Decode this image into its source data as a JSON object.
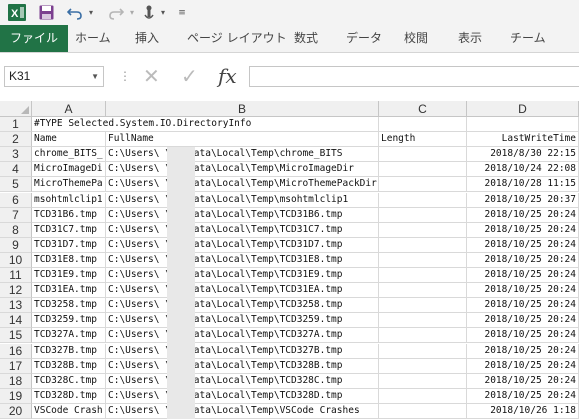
{
  "qat": {
    "excel_icon": "excel-logo-icon",
    "save_icon": "save-icon",
    "undo_icon": "undo-icon",
    "redo_icon": "redo-icon",
    "touch_icon": "touch-mode-icon",
    "customize_icon": "customize-qat-icon"
  },
  "ribbon": {
    "tabs": [
      "ファイル",
      "ホーム",
      "挿入",
      "ページ レイアウト",
      "数式",
      "データ",
      "校閲",
      "表示",
      "チーム"
    ]
  },
  "formula_bar": {
    "name_box": "K31",
    "formula": ""
  },
  "columns": [
    "A",
    "B",
    "C",
    "D"
  ],
  "rows": [
    {
      "n": "1",
      "a": "#TYPE Selected.System.IO.DirectoryInfo",
      "b": "",
      "c": "",
      "d": ""
    },
    {
      "n": "2",
      "a": "Name",
      "b": "FullName",
      "c": "Length",
      "d": "LastWriteTime"
    },
    {
      "n": "3",
      "a": "chrome_BITS_",
      "b": "C:\\Users\\     \\AppData\\Local\\Temp\\chrome_BITS",
      "c": "",
      "d": "2018/8/30 22:15"
    },
    {
      "n": "4",
      "a": "MicroImageDi",
      "b": "C:\\Users\\     \\AppData\\Local\\Temp\\MicroImageDir",
      "c": "",
      "d": "2018/10/24 22:08"
    },
    {
      "n": "5",
      "a": "MicroThemePa",
      "b": "C:\\Users\\     \\AppData\\Local\\Temp\\MicroThemePackDir",
      "c": "",
      "d": "2018/10/28 11:15"
    },
    {
      "n": "6",
      "a": "msohtmlclip1",
      "b": "C:\\Users\\     \\AppData\\Local\\Temp\\msohtmlclip1",
      "c": "",
      "d": "2018/10/25 20:37"
    },
    {
      "n": "7",
      "a": "TCD31B6.tmp",
      "b": "C:\\Users\\     \\AppData\\Local\\Temp\\TCD31B6.tmp",
      "c": "",
      "d": "2018/10/25 20:24"
    },
    {
      "n": "8",
      "a": "TCD31C7.tmp",
      "b": "C:\\Users\\     \\AppData\\Local\\Temp\\TCD31C7.tmp",
      "c": "",
      "d": "2018/10/25 20:24"
    },
    {
      "n": "9",
      "a": "TCD31D7.tmp",
      "b": "C:\\Users\\     \\AppData\\Local\\Temp\\TCD31D7.tmp",
      "c": "",
      "d": "2018/10/25 20:24"
    },
    {
      "n": "10",
      "a": "TCD31E8.tmp",
      "b": "C:\\Users\\     \\AppData\\Local\\Temp\\TCD31E8.tmp",
      "c": "",
      "d": "2018/10/25 20:24"
    },
    {
      "n": "11",
      "a": "TCD31E9.tmp",
      "b": "C:\\Users\\     \\AppData\\Local\\Temp\\TCD31E9.tmp",
      "c": "",
      "d": "2018/10/25 20:24"
    },
    {
      "n": "12",
      "a": "TCD31EA.tmp",
      "b": "C:\\Users\\     \\AppData\\Local\\Temp\\TCD31EA.tmp",
      "c": "",
      "d": "2018/10/25 20:24"
    },
    {
      "n": "13",
      "a": "TCD3258.tmp",
      "b": "C:\\Users\\     \\AppData\\Local\\Temp\\TCD3258.tmp",
      "c": "",
      "d": "2018/10/25 20:24"
    },
    {
      "n": "14",
      "a": "TCD3259.tmp",
      "b": "C:\\Users\\     \\AppData\\Local\\Temp\\TCD3259.tmp",
      "c": "",
      "d": "2018/10/25 20:24"
    },
    {
      "n": "15",
      "a": "TCD327A.tmp",
      "b": "C:\\Users\\     \\AppData\\Local\\Temp\\TCD327A.tmp",
      "c": "",
      "d": "2018/10/25 20:24"
    },
    {
      "n": "16",
      "a": "TCD327B.tmp",
      "b": "C:\\Users\\     \\AppData\\Local\\Temp\\TCD327B.tmp",
      "c": "",
      "d": "2018/10/25 20:24"
    },
    {
      "n": "17",
      "a": "TCD328B.tmp",
      "b": "C:\\Users\\     \\AppData\\Local\\Temp\\TCD328B.tmp",
      "c": "",
      "d": "2018/10/25 20:24"
    },
    {
      "n": "18",
      "a": "TCD328C.tmp",
      "b": "C:\\Users\\     \\AppData\\Local\\Temp\\TCD328C.tmp",
      "c": "",
      "d": "2018/10/25 20:24"
    },
    {
      "n": "19",
      "a": "TCD328D.tmp",
      "b": "C:\\Users\\     \\AppData\\Local\\Temp\\TCD328D.tmp",
      "c": "",
      "d": "2018/10/25 20:24"
    },
    {
      "n": "20",
      "a": "VSCode Crash",
      "b": "C:\\Users\\     \\AppData\\Local\\Temp\\VSCode Crashes",
      "c": "",
      "d": "2018/10/26 1:18"
    }
  ],
  "colors": {
    "excel_green": "#217346",
    "ribbon_bg": "#f3f3f3",
    "header_bg": "#f0f0f0",
    "gridline": "#d9d9d9"
  }
}
